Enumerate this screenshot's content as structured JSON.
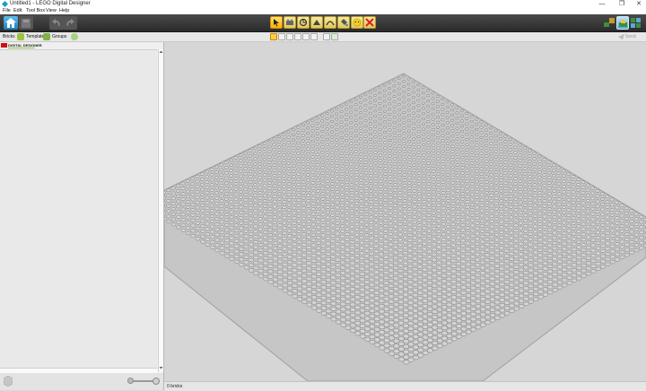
{
  "window": {
    "title": "Untitled1 - LEGO Digital Designer",
    "controls": [
      "—",
      "❐",
      "✕"
    ]
  },
  "menu": [
    "File",
    "Edit",
    "Tool Box",
    "View",
    "Help"
  ],
  "tabs": [
    {
      "label": "Bricks"
    },
    {
      "label": "Templates"
    },
    {
      "label": "Groups"
    }
  ],
  "send_label": "Send",
  "panel": {
    "logo_text": "DIGITAL DESIGNER"
  },
  "status": {
    "brick_count": "0 bricks"
  },
  "colors": {
    "accent": "#ffb000",
    "delete": "#e02020",
    "dark_toolbar": "#333333"
  }
}
